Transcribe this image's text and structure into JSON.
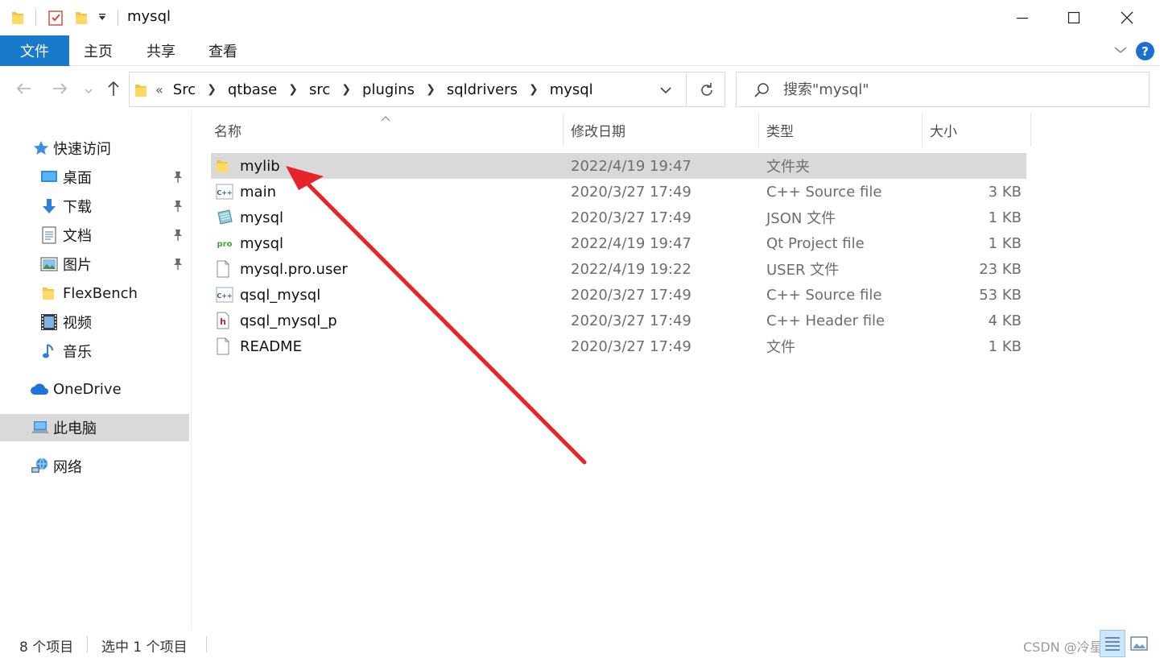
{
  "window": {
    "title": "mysql"
  },
  "ribbon": {
    "tabs": [
      "文件",
      "主页",
      "共享",
      "查看"
    ],
    "help": "?"
  },
  "address": {
    "overflow": "«",
    "crumbs": [
      "Src",
      "qtbase",
      "src",
      "plugins",
      "sqldrivers",
      "mysql"
    ]
  },
  "search": {
    "placeholder": "搜索\"mysql\""
  },
  "sidebar": {
    "quick_access": "快速访问",
    "items": [
      {
        "label": "桌面",
        "icon": "desktop-icon",
        "pinned": true
      },
      {
        "label": "下载",
        "icon": "download-icon",
        "pinned": true
      },
      {
        "label": "文档",
        "icon": "documents-icon",
        "pinned": true
      },
      {
        "label": "图片",
        "icon": "pictures-icon",
        "pinned": true
      },
      {
        "label": "FlexBench",
        "icon": "folder-icon",
        "pinned": false
      },
      {
        "label": "视频",
        "icon": "video-icon",
        "pinned": false
      },
      {
        "label": "音乐",
        "icon": "music-icon",
        "pinned": false
      }
    ],
    "onedrive": "OneDrive",
    "this_pc": "此电脑",
    "network": "网络"
  },
  "columns": {
    "name": "名称",
    "date": "修改日期",
    "type": "类型",
    "size": "大小"
  },
  "files": [
    {
      "name": "mylib",
      "date": "2022/4/19 19:47",
      "type": "文件夹",
      "size": "",
      "icon": "folder-icon",
      "selected": true
    },
    {
      "name": "main",
      "date": "2020/3/27 17:49",
      "type": "C++ Source file",
      "size": "3 KB",
      "icon": "cpp-file-icon",
      "selected": false
    },
    {
      "name": "mysql",
      "date": "2020/3/27 17:49",
      "type": "JSON 文件",
      "size": "1 KB",
      "icon": "json-file-icon",
      "selected": false
    },
    {
      "name": "mysql",
      "date": "2022/4/19 19:47",
      "type": "Qt Project file",
      "size": "1 KB",
      "icon": "qt-pro-file-icon",
      "selected": false
    },
    {
      "name": "mysql.pro.user",
      "date": "2022/4/19 19:22",
      "type": "USER 文件",
      "size": "23 KB",
      "icon": "blank-file-icon",
      "selected": false
    },
    {
      "name": "qsql_mysql",
      "date": "2020/3/27 17:49",
      "type": "C++ Source file",
      "size": "53 KB",
      "icon": "cpp-file-icon",
      "selected": false
    },
    {
      "name": "qsql_mysql_p",
      "date": "2020/3/27 17:49",
      "type": "C++ Header file",
      "size": "4 KB",
      "icon": "header-file-icon",
      "selected": false
    },
    {
      "name": "README",
      "date": "2020/3/27 17:49",
      "type": "文件",
      "size": "1 KB",
      "icon": "blank-file-icon",
      "selected": false
    }
  ],
  "status": {
    "count": "8 个项目",
    "selected": "选中 1 个项目",
    "watermark": "CSDN @冷星星x"
  },
  "colors": {
    "file_tab": "#1979ca",
    "selection": "#d9d9d9",
    "annotation_arrow": "#e8232a"
  }
}
